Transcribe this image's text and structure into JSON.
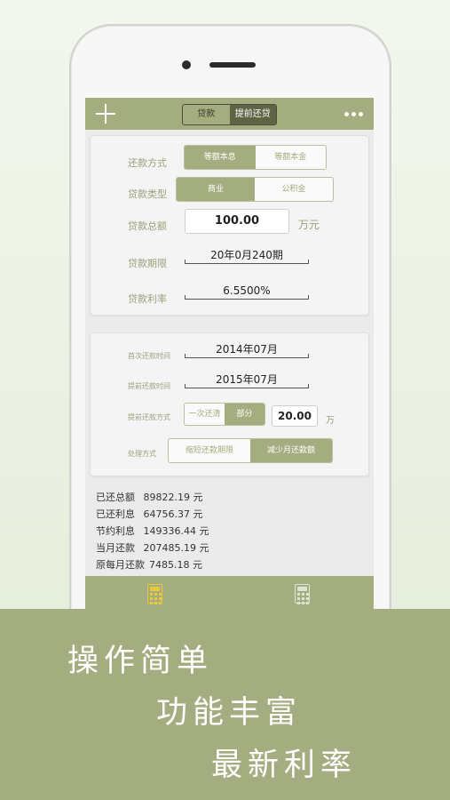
{
  "colors": {
    "accent": "#a3ad7f",
    "dark_segment": "#5f6444",
    "label": "#98a27a",
    "banner": "#a3ad7f"
  },
  "navbar": {
    "left_icon": "plus-icon",
    "tabs": [
      {
        "label": "贷款",
        "selected": false
      },
      {
        "label": "提前还贷",
        "selected": true
      }
    ],
    "right_icon": "more-dots-icon"
  },
  "loan": {
    "repay_method": {
      "label": "还款方式",
      "options": [
        "等额本息",
        "等额本金"
      ],
      "selected": 0
    },
    "loan_type": {
      "label": "贷款类型",
      "options": [
        "商业",
        "公积金"
      ],
      "selected": 0
    },
    "total": {
      "label": "贷款总额",
      "value": "100.00",
      "unit": "万元"
    },
    "term": {
      "label": "贷款期限",
      "value": "20年0月240期"
    },
    "rate": {
      "label": "贷款利率",
      "value": "6.5500%"
    }
  },
  "prepay": {
    "first_date": {
      "label": "首次还款时间",
      "value": "2014年07月"
    },
    "prepay_date": {
      "label": "提前还款时间",
      "value": "2015年07月"
    },
    "method": {
      "label": "提前还款方式",
      "options": [
        "一次还清",
        "部分"
      ],
      "selected": 1,
      "amount": "20.00",
      "unit": "万"
    },
    "handling": {
      "label": "处理方式",
      "options": [
        "缩短还款期限",
        "减少月还款额"
      ],
      "selected": 1
    }
  },
  "results": [
    {
      "key": "已还总额",
      "value": "89822.19 元"
    },
    {
      "key": "已还利息",
      "value": "64756.37 元"
    },
    {
      "key": "节约利息",
      "value": "149336.44 元"
    },
    {
      "key": "当月还款",
      "value": "207485.19 元"
    },
    {
      "key": "原每月还款",
      "value": "7485.18 元"
    }
  ],
  "tabbar": {
    "items": [
      {
        "icon": "calculator-icon",
        "active": true
      },
      {
        "icon": "calculator-icon",
        "active": false
      }
    ]
  },
  "slogans": [
    "操作简单",
    "功能丰富",
    "最新利率"
  ]
}
